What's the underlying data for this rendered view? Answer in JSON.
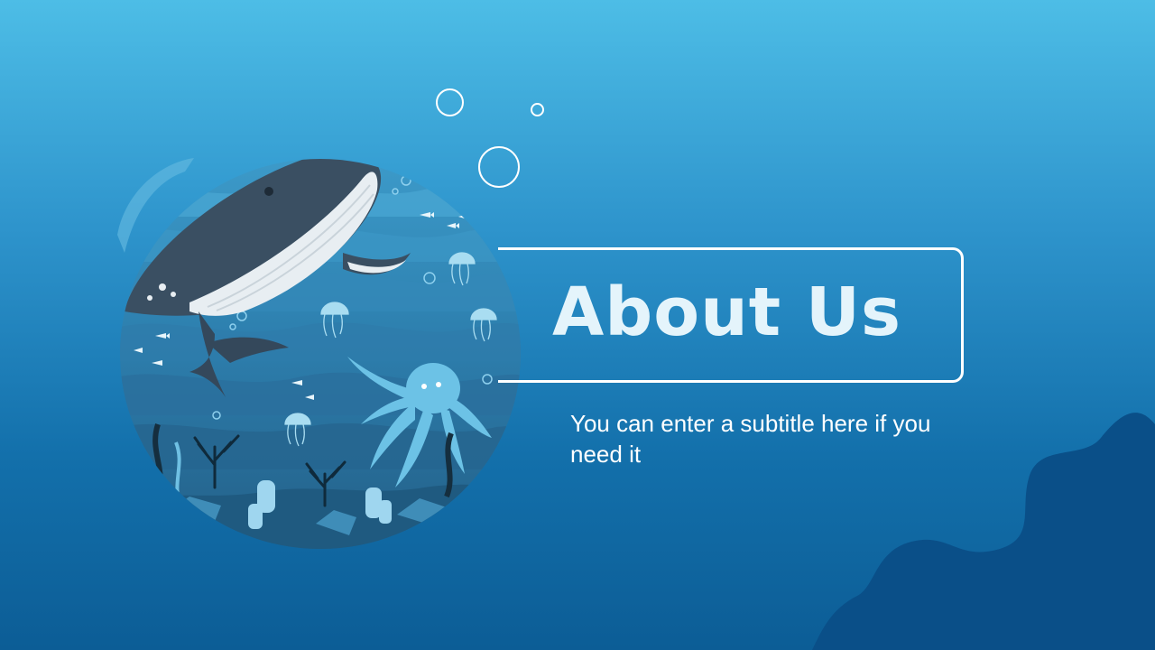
{
  "slide": {
    "title": "About Us",
    "subtitle": "You can enter a subtitle here if you need it"
  },
  "colors": {
    "background_top": "#4dbde6",
    "background_bottom": "#0c5d96",
    "accent_blob": "#0a4f88",
    "title_text": "#e4f4fb",
    "outline": "#ffffff"
  },
  "icons": [
    "bubble-icon",
    "whale-icon",
    "jellyfish-icon",
    "octopus-icon",
    "coral-icon",
    "fish-icon"
  ]
}
